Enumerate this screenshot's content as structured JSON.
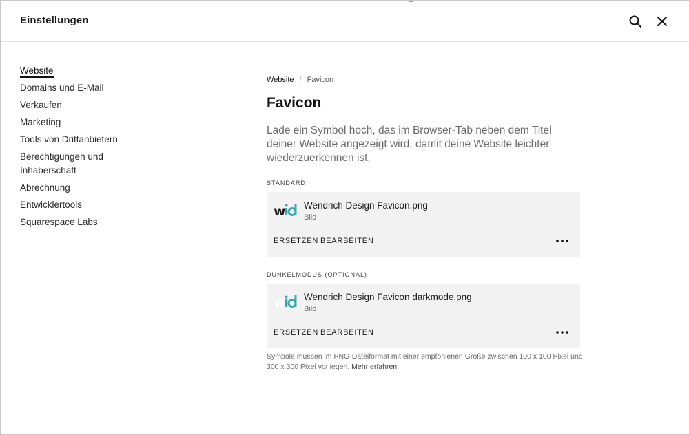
{
  "header": {
    "title": "Einstellungen"
  },
  "sidebar": {
    "items": [
      {
        "label": "Website",
        "active": true
      },
      {
        "label": "Domains und E-Mail"
      },
      {
        "label": "Verkaufen"
      },
      {
        "label": "Marketing"
      },
      {
        "label": "Tools von Drittanbietern"
      },
      {
        "label": "Berechtigungen und Inhaberschaft"
      },
      {
        "label": "Abrechnung"
      },
      {
        "label": "Entwicklertools"
      },
      {
        "label": "Squarespace Labs"
      }
    ]
  },
  "breadcrumb": {
    "parent": "Website",
    "separator": "/",
    "current": "Favicon"
  },
  "page": {
    "title": "Favicon",
    "description": "Lade ein Symbol hoch, das im Browser-Tab neben dem Titel deiner Website angezeigt wird, damit deine Website leichter wiederzuerkennen ist."
  },
  "standard": {
    "label": "STANDARD",
    "file_name": "Wendrich Design Favicon.png",
    "file_type": "Bild",
    "replace_label": "ERSETZEN",
    "edit_label": "BEARBEITEN"
  },
  "darkmode": {
    "label": "DUNKELMODUS (OPTIONAL)",
    "file_name": "Wendrich Design Favicon darkmode.png",
    "file_type": "Bild",
    "replace_label": "ERSETZEN",
    "edit_label": "BEARBEITEN"
  },
  "footnote": {
    "text": "Symbole müssen im PNG-Dateiformat mit einer empfohlenen Größe zwischen 100 x 100 Pixel und 300 x 300 Pixel vorliegen.",
    "link": "Mehr erfahren"
  },
  "icons": {
    "search": "search-icon",
    "close": "close-icon",
    "more": "more-horizontal-icon",
    "favicon": "wid-logo"
  },
  "colors": {
    "accent_teal": "#3aa7b5",
    "logo_dark": "#1c1c1c",
    "card_bg": "#f2f2f2"
  }
}
